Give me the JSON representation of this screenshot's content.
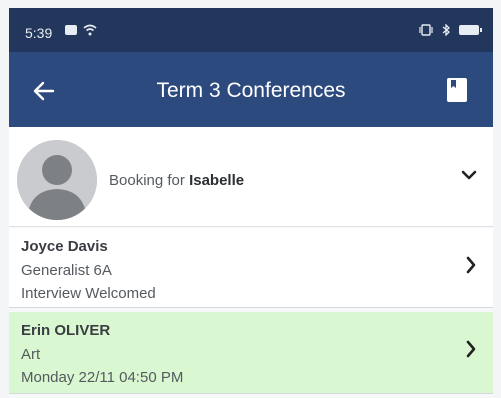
{
  "status_bar": {
    "time": "5:39",
    "left_icons": [
      "notification-icon",
      "wifi-icon"
    ],
    "right_icons": [
      "vibrate-icon",
      "bluetooth-icon",
      "battery-icon"
    ]
  },
  "app_bar": {
    "title": "Term 3 Conferences",
    "back_icon": "arrow-left-icon",
    "action_icon": "bookmark-icon"
  },
  "booking": {
    "prefix": "Booking for",
    "student": "Isabelle",
    "avatar": "default-avatar-icon",
    "expand_icon": "chevron-down-icon"
  },
  "teachers": [
    {
      "name": "Joyce Davis",
      "subject": "Generalist 6A",
      "status": "Interview Welcomed"
    },
    {
      "name": "Erin OLIVER",
      "subject": "Art",
      "status": "Monday 22/11 04:50 PM"
    }
  ],
  "colors": {
    "status_bar": "#23375d",
    "app_bar": "#2d4a7e",
    "booked_row": "#d9f7d1"
  }
}
